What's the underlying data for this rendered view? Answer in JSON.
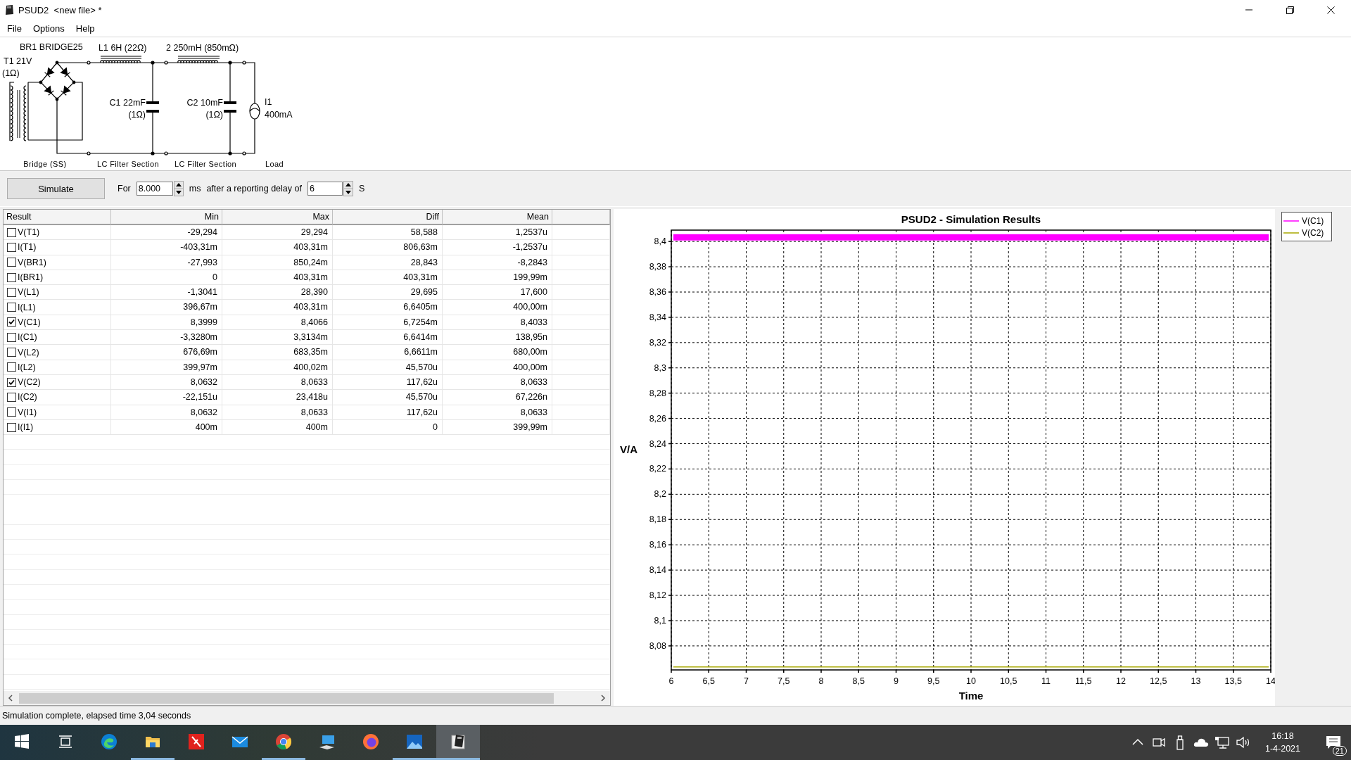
{
  "window": {
    "title": "PSUD2  <new file> *"
  },
  "menu": [
    "File",
    "Options",
    "Help"
  ],
  "schematic": {
    "transformer": {
      "name": "T1 21V",
      "resistance": "(1Ω)"
    },
    "bridge": {
      "name": "BR1 BRIDGE25"
    },
    "inductors": [
      {
        "name": "L1 6H (22Ω)"
      },
      {
        "name": "2 250mH (850mΩ)"
      }
    ],
    "capacitors": [
      {
        "name": "C1 22mF",
        "resistance": "(1Ω)"
      },
      {
        "name": "C2 10mF",
        "resistance": "(1Ω)"
      }
    ],
    "load": {
      "name": "I1",
      "value": "400mA"
    },
    "sections": [
      "Bridge (SS)",
      "LC Filter Section",
      "LC Filter Section",
      "Load"
    ]
  },
  "toolbar": {
    "button": "Simulate",
    "for_label": "For",
    "duration": "8.000",
    "duration_unit": "ms",
    "delay_label": "after a reporting delay of",
    "delay": "6",
    "delay_unit": "S"
  },
  "table": {
    "columns": [
      "Result",
      "Min",
      "Max",
      "Diff",
      "Mean"
    ],
    "rows": [
      {
        "name": "V(T1)",
        "checked": false,
        "min": "-29,294",
        "max": "29,294",
        "diff": "58,588",
        "mean": "1,2537u"
      },
      {
        "name": "I(T1)",
        "checked": false,
        "min": "-403,31m",
        "max": "403,31m",
        "diff": "806,63m",
        "mean": "-1,2537u"
      },
      {
        "name": "V(BR1)",
        "checked": false,
        "min": "-27,993",
        "max": "850,24m",
        "diff": "28,843",
        "mean": "-8,2843"
      },
      {
        "name": "I(BR1)",
        "checked": false,
        "min": "0",
        "max": "403,31m",
        "diff": "403,31m",
        "mean": "199,99m"
      },
      {
        "name": "V(L1)",
        "checked": false,
        "min": "-1,3041",
        "max": "28,390",
        "diff": "29,695",
        "mean": "17,600"
      },
      {
        "name": "I(L1)",
        "checked": false,
        "min": "396,67m",
        "max": "403,31m",
        "diff": "6,6405m",
        "mean": "400,00m"
      },
      {
        "name": "V(C1)",
        "checked": true,
        "min": "8,3999",
        "max": "8,4066",
        "diff": "6,7254m",
        "mean": "8,4033"
      },
      {
        "name": "I(C1)",
        "checked": false,
        "min": "-3,3280m",
        "max": "3,3134m",
        "diff": "6,6414m",
        "mean": "138,95n"
      },
      {
        "name": "V(L2)",
        "checked": false,
        "min": "676,69m",
        "max": "683,35m",
        "diff": "6,6611m",
        "mean": "680,00m"
      },
      {
        "name": "I(L2)",
        "checked": false,
        "min": "399,97m",
        "max": "400,02m",
        "diff": "45,570u",
        "mean": "400,00m"
      },
      {
        "name": "V(C2)",
        "checked": true,
        "min": "8,0632",
        "max": "8,0633",
        "diff": "117,62u",
        "mean": "8,0633"
      },
      {
        "name": "I(C2)",
        "checked": false,
        "min": "-22,151u",
        "max": "23,418u",
        "diff": "45,570u",
        "mean": "67,226n"
      },
      {
        "name": "V(I1)",
        "checked": false,
        "min": "8,0632",
        "max": "8,0633",
        "diff": "117,62u",
        "mean": "8,0633"
      },
      {
        "name": "I(I1)",
        "checked": false,
        "min": "400m",
        "max": "400m",
        "diff": "0",
        "mean": "399,99m"
      }
    ]
  },
  "chart": {
    "chart_data": {
      "type": "line",
      "title": "PSUD2 - Simulation Results",
      "xlabel": "Time",
      "ylabel": "V/A",
      "x": [
        6,
        14
      ],
      "series": [
        {
          "name": "V(C1)",
          "color": "#ff00ff",
          "values": [
            8.4033,
            8.4033
          ]
        },
        {
          "name": "V(C2)",
          "color": "#a8a800",
          "values": [
            8.0633,
            8.0633
          ]
        }
      ],
      "xlim": [
        6,
        14
      ],
      "ylim": [
        8.061,
        8.409
      ],
      "grid": true,
      "xticks": [
        {
          "value": 6,
          "label": "6"
        },
        {
          "value": 6.5,
          "label": "6,5"
        },
        {
          "value": 7,
          "label": "7"
        },
        {
          "value": 7.5,
          "label": "7,5"
        },
        {
          "value": 8,
          "label": "8"
        },
        {
          "value": 8.5,
          "label": "8,5"
        },
        {
          "value": 9,
          "label": "9"
        },
        {
          "value": 9.5,
          "label": "9,5"
        },
        {
          "value": 10,
          "label": "10"
        },
        {
          "value": 10.5,
          "label": "10,5"
        },
        {
          "value": 11,
          "label": "11"
        },
        {
          "value": 11.5,
          "label": "11,5"
        },
        {
          "value": 12,
          "label": "12"
        },
        {
          "value": 12.5,
          "label": "12,5"
        },
        {
          "value": 13,
          "label": "13"
        },
        {
          "value": 13.5,
          "label": "13,5"
        },
        {
          "value": 14,
          "label": "14"
        }
      ],
      "yticks": [
        {
          "value": 8.08,
          "label": "8,08"
        },
        {
          "value": 8.1,
          "label": "8,1"
        },
        {
          "value": 8.12,
          "label": "8,12"
        },
        {
          "value": 8.14,
          "label": "8,14"
        },
        {
          "value": 8.16,
          "label": "8,16"
        },
        {
          "value": 8.18,
          "label": "8,18"
        },
        {
          "value": 8.2,
          "label": "8,2"
        },
        {
          "value": 8.22,
          "label": "8,22"
        },
        {
          "value": 8.24,
          "label": "8,24"
        },
        {
          "value": 8.26,
          "label": "8,26"
        },
        {
          "value": 8.28,
          "label": "8,28"
        },
        {
          "value": 8.3,
          "label": "8,3"
        },
        {
          "value": 8.32,
          "label": "8,32"
        },
        {
          "value": 8.34,
          "label": "8,34"
        },
        {
          "value": 8.36,
          "label": "8,36"
        },
        {
          "value": 8.38,
          "label": "8,38"
        },
        {
          "value": 8.4,
          "label": "8,4"
        }
      ]
    }
  },
  "status_bar": "Simulation complete, elapsed time 3,04 seconds",
  "taskbar": {
    "apps": [
      {
        "kind": "start",
        "running": false,
        "active": false
      },
      {
        "kind": "taskview",
        "running": false,
        "active": false
      },
      {
        "kind": "edge",
        "running": false,
        "active": false
      },
      {
        "kind": "folder",
        "running": true,
        "active": false
      },
      {
        "kind": "redapp",
        "running": false,
        "active": false
      },
      {
        "kind": "mail",
        "running": false,
        "active": false
      },
      {
        "kind": "chrome",
        "running": true,
        "active": false
      },
      {
        "kind": "computer",
        "running": false,
        "active": false
      },
      {
        "kind": "firefox",
        "running": false,
        "active": false
      },
      {
        "kind": "photos",
        "running": true,
        "active": false
      },
      {
        "kind": "psud",
        "running": true,
        "active": true
      }
    ],
    "time": "16:18",
    "date": "1-4-2021",
    "notifications": "21"
  }
}
